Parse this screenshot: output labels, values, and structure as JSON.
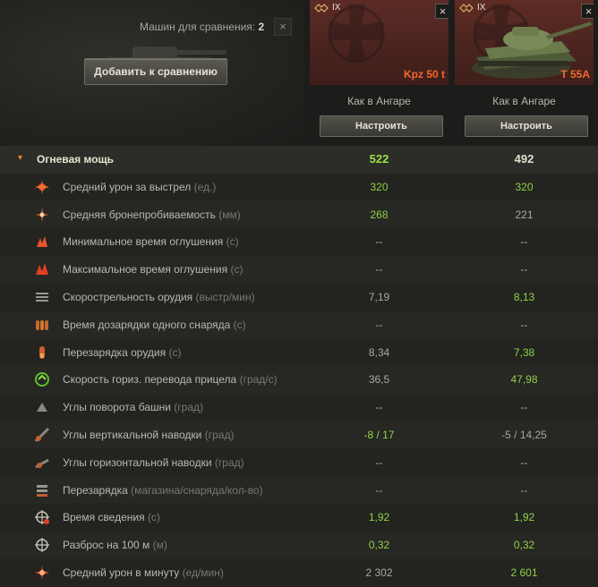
{
  "header": {
    "compare_count_label": "Машин для сравнения:",
    "compare_count": "2",
    "close_symbol": "×",
    "add_button_label": "Добавить к сравнению"
  },
  "vehicles": [
    {
      "tier": "IX",
      "name": "Kpz 50 t",
      "config": "Как в Ангаре",
      "tune_label": "Настроить",
      "close_symbol": "×"
    },
    {
      "tier": "IX",
      "name": "T 55A",
      "config": "Как в Ангаре",
      "tune_label": "Настроить",
      "close_symbol": "×"
    }
  ],
  "section": {
    "arrow": "▾",
    "title": "Огневая мощь",
    "values": [
      {
        "text": "522",
        "highlight": true
      },
      {
        "text": "492",
        "highlight": false
      }
    ]
  },
  "rows": [
    {
      "icon": "damage-icon",
      "label": "Средний урон за выстрел",
      "unit": "(ед.)",
      "v1": "320",
      "g1": true,
      "v2": "320",
      "g2": true
    },
    {
      "icon": "penetration-icon",
      "label": "Средняя бронепробиваемость",
      "unit": "(мм)",
      "v1": "268",
      "g1": true,
      "v2": "221",
      "g2": false
    },
    {
      "icon": "stun-min-icon",
      "label": "Минимальное время оглушения",
      "unit": "(с)",
      "v1": "--",
      "g1": false,
      "v2": "--",
      "g2": false
    },
    {
      "icon": "stun-max-icon",
      "label": "Максимальное время оглушения",
      "unit": "(с)",
      "v1": "--",
      "g1": false,
      "v2": "--",
      "g2": false
    },
    {
      "icon": "rate-of-fire-icon",
      "label": "Скорострельность орудия",
      "unit": "(выстр/мин)",
      "v1": "7,19",
      "g1": false,
      "v2": "8,13",
      "g2": true
    },
    {
      "icon": "intra-clip-reload-icon",
      "label": "Время дозарядки одного снаряда",
      "unit": "(с)",
      "v1": "--",
      "g1": false,
      "v2": "--",
      "g2": false
    },
    {
      "icon": "reload-icon",
      "label": "Перезарядка орудия",
      "unit": "(с)",
      "v1": "8,34",
      "g1": false,
      "v2": "7,38",
      "g2": true
    },
    {
      "icon": "traverse-speed-icon",
      "label": "Скорость гориз. перевода прицела",
      "unit": "(град/с)",
      "v1": "36,5",
      "g1": false,
      "v2": "47,98",
      "g2": true
    },
    {
      "icon": "turret-angles-icon",
      "label": "Углы поворота башни",
      "unit": "(град)",
      "v1": "--",
      "g1": false,
      "v2": "--",
      "g2": false
    },
    {
      "icon": "elevation-angles-icon",
      "label": "Углы вертикальной наводки",
      "unit": "(град)",
      "v1": "-8 / 17",
      "g1": true,
      "v2": "-5 / 14,25",
      "g2": false
    },
    {
      "icon": "horizontal-angles-icon",
      "label": "Углы горизонтальной наводки",
      "unit": "(град)",
      "v1": "--",
      "g1": false,
      "v2": "--",
      "g2": false
    },
    {
      "icon": "magazine-reload-icon",
      "label": "Перезарядка",
      "unit": "(магазина/снаряда/кол-во)",
      "v1": "--",
      "g1": false,
      "v2": "--",
      "g2": false
    },
    {
      "icon": "aim-time-icon",
      "label": "Время сведения",
      "unit": "(с)",
      "v1": "1,92",
      "g1": true,
      "v2": "1,92",
      "g2": true
    },
    {
      "icon": "dispersion-icon",
      "label": "Разброс на 100 м",
      "unit": "(м)",
      "v1": "0,32",
      "g1": true,
      "v2": "0,32",
      "g2": true
    },
    {
      "icon": "dpm-icon",
      "label": "Средний урон в минуту",
      "unit": "(ед/мин)",
      "v1": "2 302",
      "g1": false,
      "v2": "2 601",
      "g2": true
    }
  ],
  "colors": {
    "highlight": "#8fd146",
    "vehicle_name": "#ef6a2c",
    "accent_arrow": "#e88a2a"
  }
}
